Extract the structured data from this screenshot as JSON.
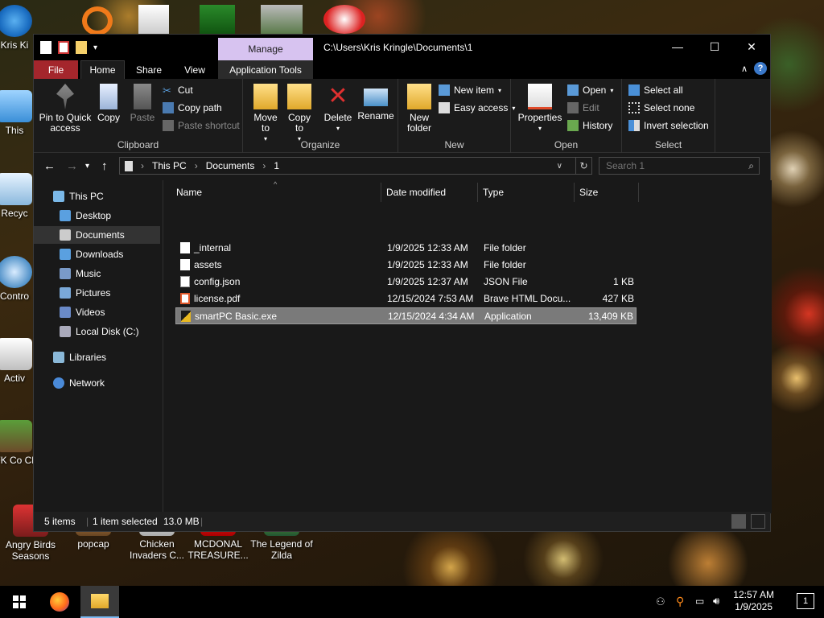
{
  "desktop": {
    "icons": [
      {
        "label": "Kris Ki"
      },
      {
        "label": "This"
      },
      {
        "label": "Recyc"
      },
      {
        "label": "Contro"
      },
      {
        "label": "Activ"
      },
      {
        "label": "AFK Co Clic"
      },
      {
        "label": "Angry Birds Seasons"
      },
      {
        "label": "popcap"
      },
      {
        "label": "Chicken Invaders C..."
      },
      {
        "label": "MCDONAL TREASURE..."
      },
      {
        "label": "The Legend of Zilda"
      }
    ]
  },
  "window": {
    "manage_tab": "Manage",
    "title_path": "C:\\Users\\Kris Kringle\\Documents\\1",
    "controls": {
      "minimize": "—",
      "maximize": "☐",
      "close": "✕"
    },
    "tabs": {
      "file": "File",
      "home": "Home",
      "share": "Share",
      "view": "View",
      "app_tools": "Application Tools"
    },
    "help": "?",
    "ribbon": {
      "clipboard": {
        "label": "Clipboard",
        "pin": "Pin to Quick access",
        "copy": "Copy",
        "paste": "Paste",
        "cut": "Cut",
        "copy_path": "Copy path",
        "paste_shortcut": "Paste shortcut"
      },
      "organize": {
        "label": "Organize",
        "move_to": "Move to",
        "copy_to": "Copy to",
        "delete": "Delete",
        "rename": "Rename"
      },
      "new": {
        "label": "New",
        "new_folder": "New folder",
        "new_item": "New item",
        "easy_access": "Easy access"
      },
      "open": {
        "label": "Open",
        "properties": "Properties",
        "open": "Open",
        "edit": "Edit",
        "history": "History"
      },
      "select": {
        "label": "Select",
        "select_all": "Select all",
        "select_none": "Select none",
        "invert": "Invert selection"
      }
    },
    "address": {
      "crumbs": [
        "This PC",
        "Documents",
        "1"
      ],
      "search_placeholder": "Search 1"
    },
    "nav": [
      {
        "label": "This PC"
      },
      {
        "label": "Desktop"
      },
      {
        "label": "Documents"
      },
      {
        "label": "Downloads"
      },
      {
        "label": "Music"
      },
      {
        "label": "Pictures"
      },
      {
        "label": "Videos"
      },
      {
        "label": "Local Disk (C:)"
      },
      {
        "label": "Libraries"
      },
      {
        "label": "Network"
      }
    ],
    "columns": {
      "name": "Name",
      "date": "Date modified",
      "type": "Type",
      "size": "Size"
    },
    "files": [
      {
        "name": "_internal",
        "date": "1/9/2025 12:33 AM",
        "type": "File folder",
        "size": ""
      },
      {
        "name": "assets",
        "date": "1/9/2025 12:33 AM",
        "type": "File folder",
        "size": ""
      },
      {
        "name": "config.json",
        "date": "1/9/2025 12:37 AM",
        "type": "JSON File",
        "size": "1 KB"
      },
      {
        "name": "license.pdf",
        "date": "12/15/2024 7:53 AM",
        "type": "Brave HTML Docu...",
        "size": "427 KB"
      },
      {
        "name": "smartPC Basic.exe",
        "date": "12/15/2024 4:34 AM",
        "type": "Application",
        "size": "13,409 KB"
      }
    ],
    "status": {
      "items": "5 items",
      "selected": "1 item selected",
      "size": "13.0 MB"
    }
  },
  "taskbar": {
    "time": "12:57 AM",
    "date": "1/9/2025",
    "notification_count": "1"
  },
  "colors": {
    "accent_file_tab": "#a4262c",
    "manage_tab": "#d7c3f0",
    "selection": "#7a7a7a"
  }
}
